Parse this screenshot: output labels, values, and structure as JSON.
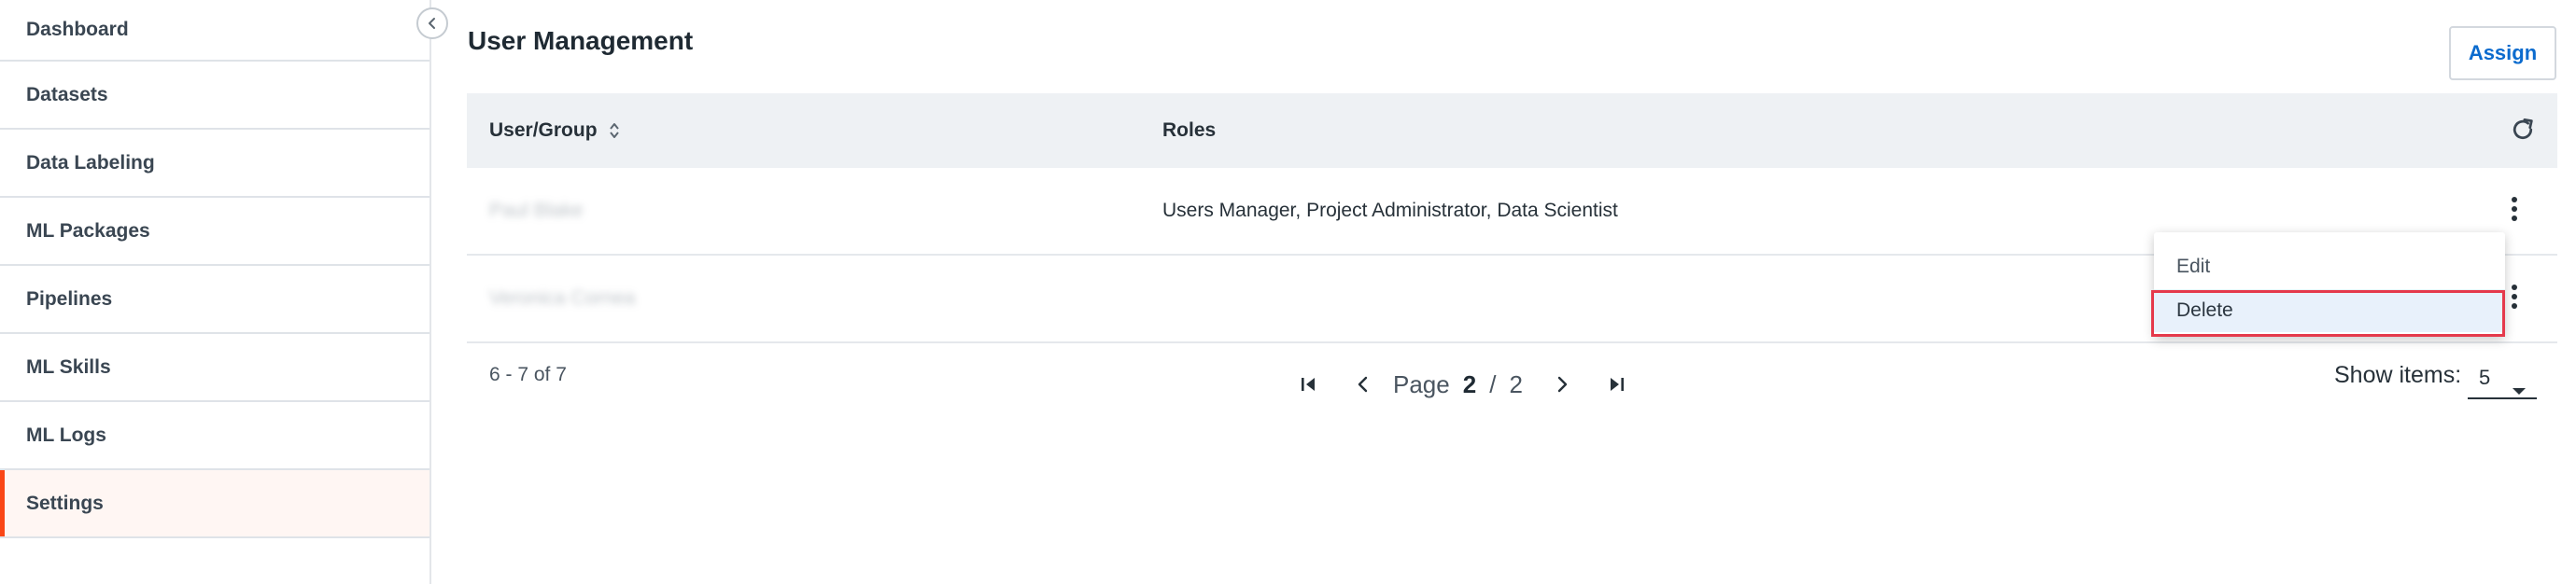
{
  "sidebar": {
    "items": [
      {
        "label": "Dashboard"
      },
      {
        "label": "Datasets"
      },
      {
        "label": "Data Labeling"
      },
      {
        "label": "ML Packages"
      },
      {
        "label": "Pipelines"
      },
      {
        "label": "ML Skills"
      },
      {
        "label": "ML Logs"
      },
      {
        "label": "Settings",
        "active": true
      }
    ],
    "collapse_icon": "chevron-left-icon"
  },
  "page": {
    "title": "User Management",
    "assign_label": "Assign"
  },
  "table": {
    "columns": [
      "User/Group",
      "Roles"
    ],
    "rows": [
      {
        "user": "Paul Blake",
        "roles": "Users Manager, Project Administrator, Data Scientist"
      },
      {
        "user": "Veronica Cornea",
        "roles": ""
      }
    ]
  },
  "pagination": {
    "range_text": "6 - 7 of 7",
    "page_word": "Page",
    "current_page": "2",
    "separator": "/",
    "total_pages": "2",
    "show_items_label": "Show items:",
    "page_size": "5"
  },
  "context_menu": {
    "items": [
      "Edit",
      "Delete"
    ],
    "highlighted": "Delete"
  },
  "colors": {
    "accent": "#fa4616",
    "link": "#0b6bce",
    "highlight_border": "#e5394b",
    "selected_menu_bg": "#e8f1fb"
  }
}
